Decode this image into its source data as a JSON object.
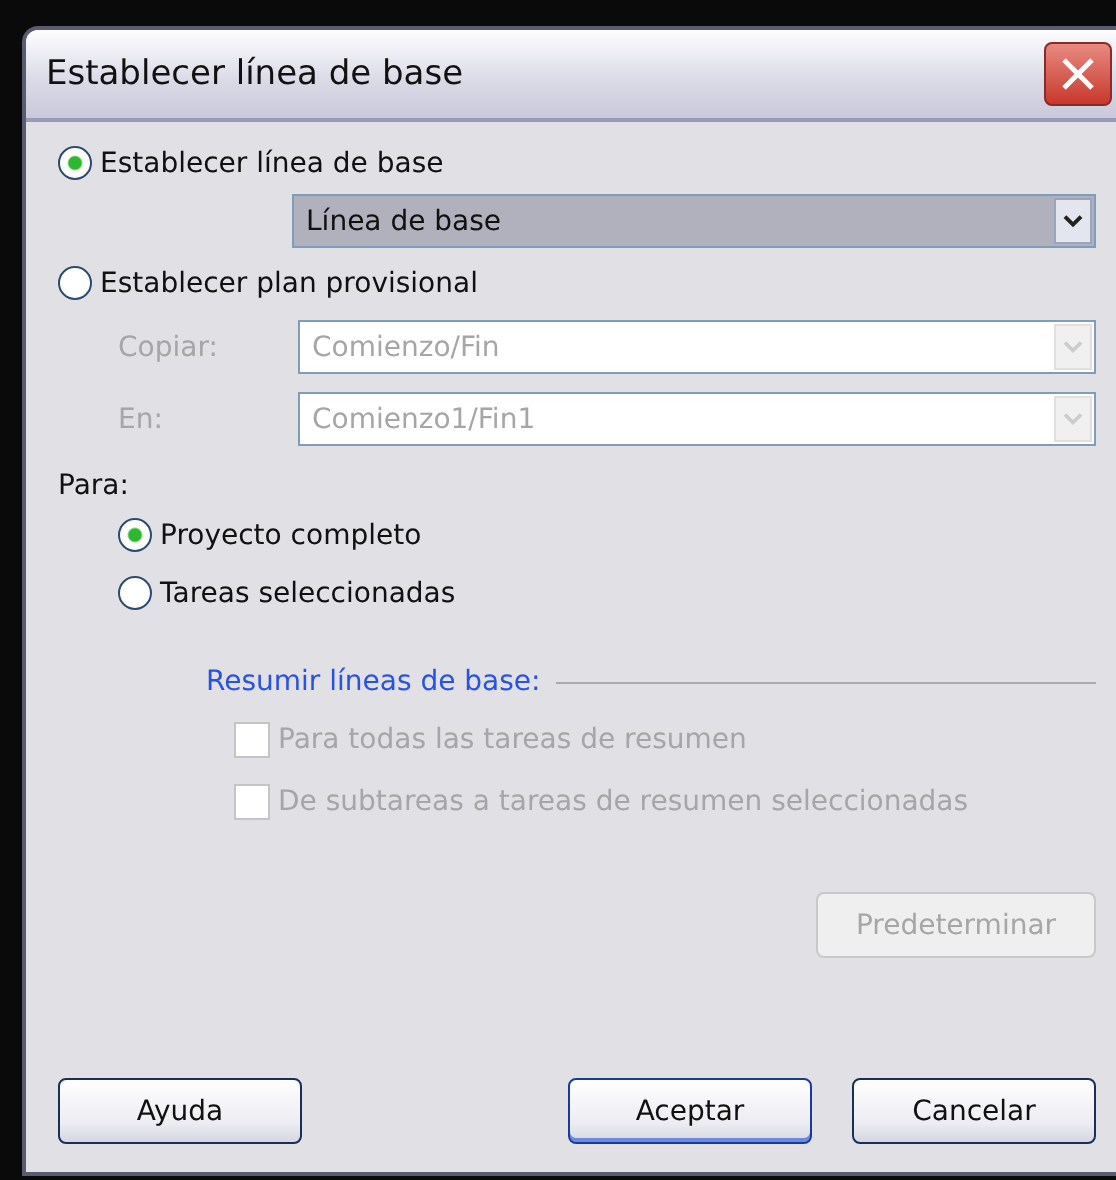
{
  "window": {
    "title": "Establecer línea de base"
  },
  "mode_options": [
    {
      "label": "Establecer línea de base",
      "selected": true
    },
    {
      "label": "Establecer plan provisional",
      "selected": false
    }
  ],
  "baseline_select": {
    "value": "Línea de base"
  },
  "interim_fields": [
    {
      "label": "Copiar:",
      "value": "Comienzo/Fin",
      "disabled": true
    },
    {
      "label": "En:",
      "value": "Comienzo1/Fin1",
      "disabled": true
    }
  ],
  "scope": {
    "label": "Para:",
    "options": [
      {
        "label": "Proyecto completo",
        "selected": true
      },
      {
        "label": "Tareas seleccionadas",
        "selected": false
      }
    ]
  },
  "rollup": {
    "title": "Resumir líneas de base:",
    "options": [
      {
        "label": "Para todas las tareas de resumen",
        "checked": false,
        "disabled": true
      },
      {
        "label": "De subtareas a tareas de resumen seleccionadas",
        "checked": false,
        "disabled": true
      }
    ]
  },
  "default_button": {
    "label": "Predeterminar",
    "disabled": true
  },
  "buttons": [
    {
      "label": "Ayuda",
      "kind": "left"
    },
    {
      "label": "Aceptar",
      "kind": "primary"
    },
    {
      "label": "Cancelar",
      "kind": "normal"
    }
  ]
}
